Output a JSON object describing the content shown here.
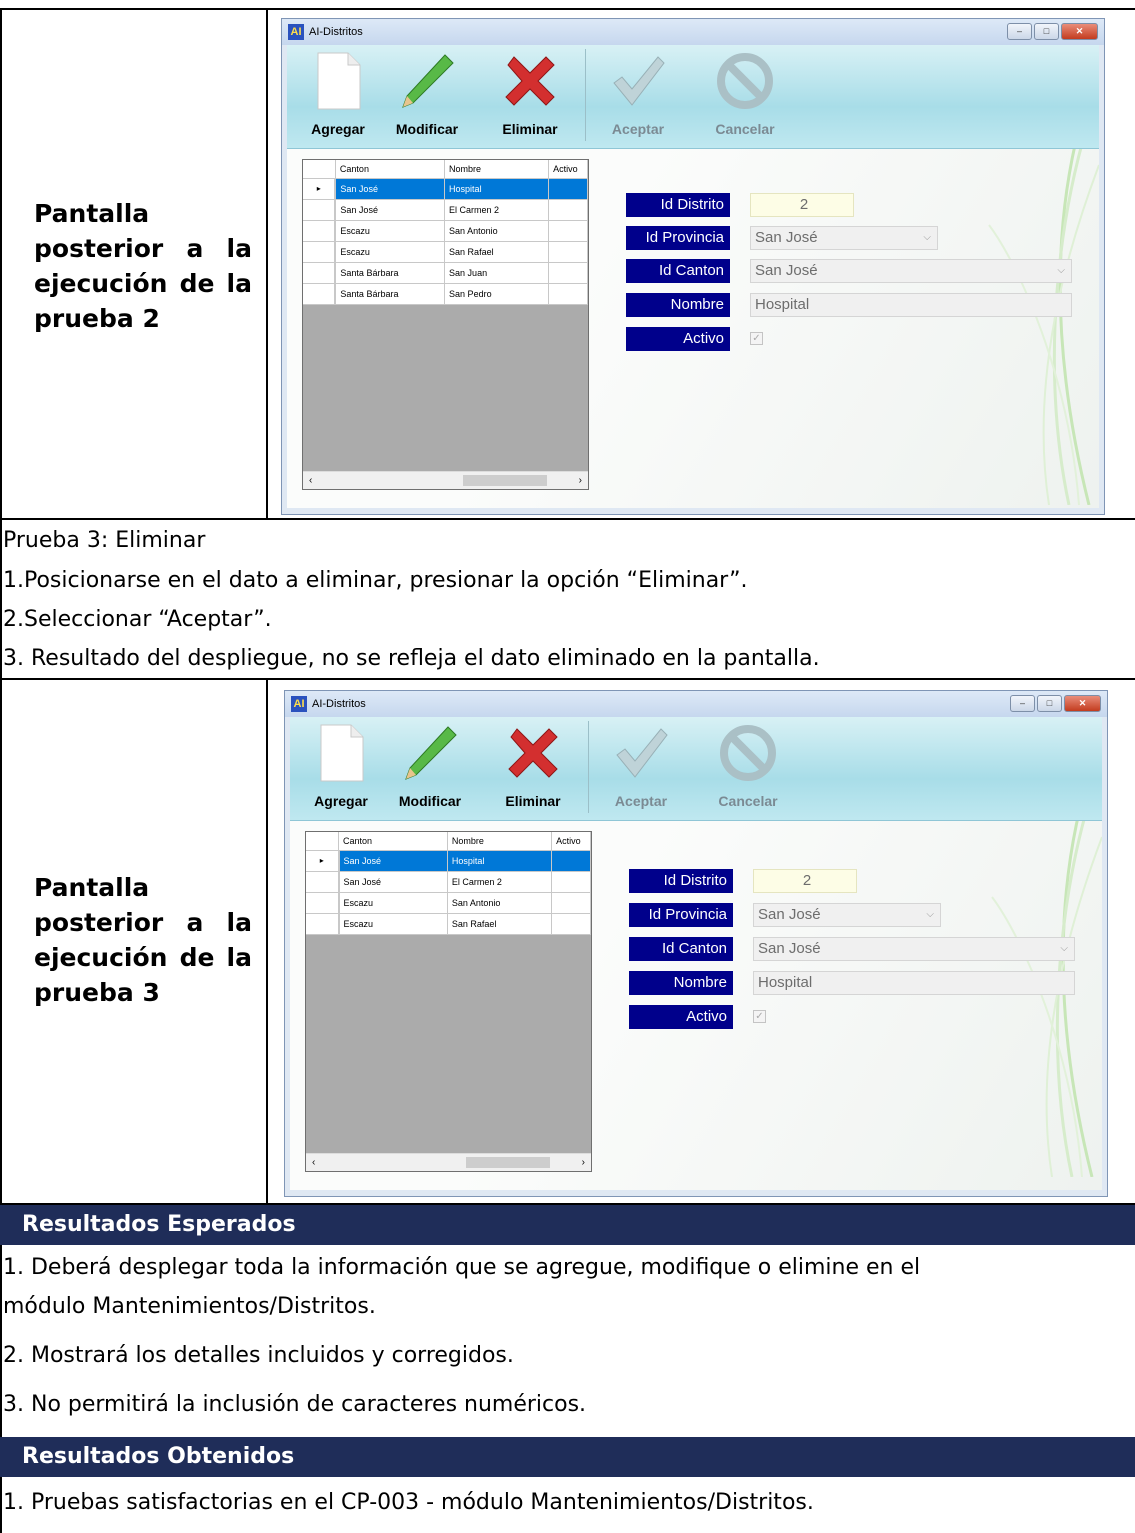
{
  "section1": {
    "label_lines": [
      [
        "Pantalla"
      ],
      [
        "posterior",
        "a",
        "la"
      ],
      [
        "ejecución",
        "de",
        "la"
      ],
      [
        "prueba 2"
      ]
    ]
  },
  "prueba3": {
    "title": "Prueba 3: Eliminar",
    "steps": [
      "1.Posicionarse en el dato a eliminar, presionar la opción “Eliminar”.",
      "2.Seleccionar “Aceptar”.",
      "3. Resultado del despliegue, no se refleja el dato eliminado en la pantalla."
    ]
  },
  "section2": {
    "label_lines": [
      [
        "Pantalla"
      ],
      [
        "posterior",
        "a",
        "la"
      ],
      [
        "ejecución",
        "de",
        "la"
      ],
      [
        "prueba 3"
      ]
    ]
  },
  "window": {
    "title": "AI-Distritos",
    "logo": "AI",
    "toolbar": {
      "agregar": "Agregar",
      "modificar": "Modificar",
      "eliminar": "Eliminar",
      "aceptar": "Aceptar",
      "cancelar": "Cancelar"
    },
    "grid": {
      "columns": [
        "Canton",
        "Nombre",
        "Activo"
      ]
    },
    "form": {
      "id_distrito_label": "Id Distrito",
      "id_distrito_value": "2",
      "id_provincia_label": "Id Provincia",
      "id_provincia_value": "San José",
      "id_canton_label": "Id Canton",
      "id_canton_value": "San José",
      "nombre_label": "Nombre",
      "nombre_value": "Hospital",
      "activo_label": "Activo",
      "activo_checked": true
    },
    "icons": [
      "new-document-icon",
      "pencil-icon",
      "red-x-icon",
      "checkmark-icon",
      "cancel-circle-icon"
    ]
  },
  "screen1_rows": [
    [
      "San José",
      "Hospital"
    ],
    [
      "San José",
      "El Carmen 2"
    ],
    [
      "Escazu",
      "San Antonio"
    ],
    [
      "Escazu",
      "San Rafael"
    ],
    [
      "Santa Bárbara",
      "San Juan"
    ],
    [
      "Santa Bárbara",
      "San Pedro"
    ]
  ],
  "screen2_rows": [
    [
      "San José",
      "Hospital"
    ],
    [
      "San José",
      "El Carmen 2"
    ],
    [
      "Escazu",
      "San Antonio"
    ],
    [
      "Escazu",
      "San Rafael"
    ]
  ],
  "resultados_esperados": {
    "header": "Resultados Esperados",
    "item1_line1": "1. Deberá desplegar toda la información que se agregue, modifique o elimine en el",
    "item1_line2": "módulo Mantenimientos/Distritos.",
    "item2": "2. Mostrará los detalles incluidos y corregidos.",
    "item3": "3. No permitirá la inclusión de caracteres numéricos."
  },
  "resultados_obtenidos": {
    "header": "Resultados Obtenidos",
    "item1": "1. Pruebas satisfactorias en el CP-003 - módulo Mantenimientos/Distritos."
  },
  "colors": {
    "band": "#1f2d59",
    "field_label": "#00008b",
    "selection": "#0078d7"
  }
}
